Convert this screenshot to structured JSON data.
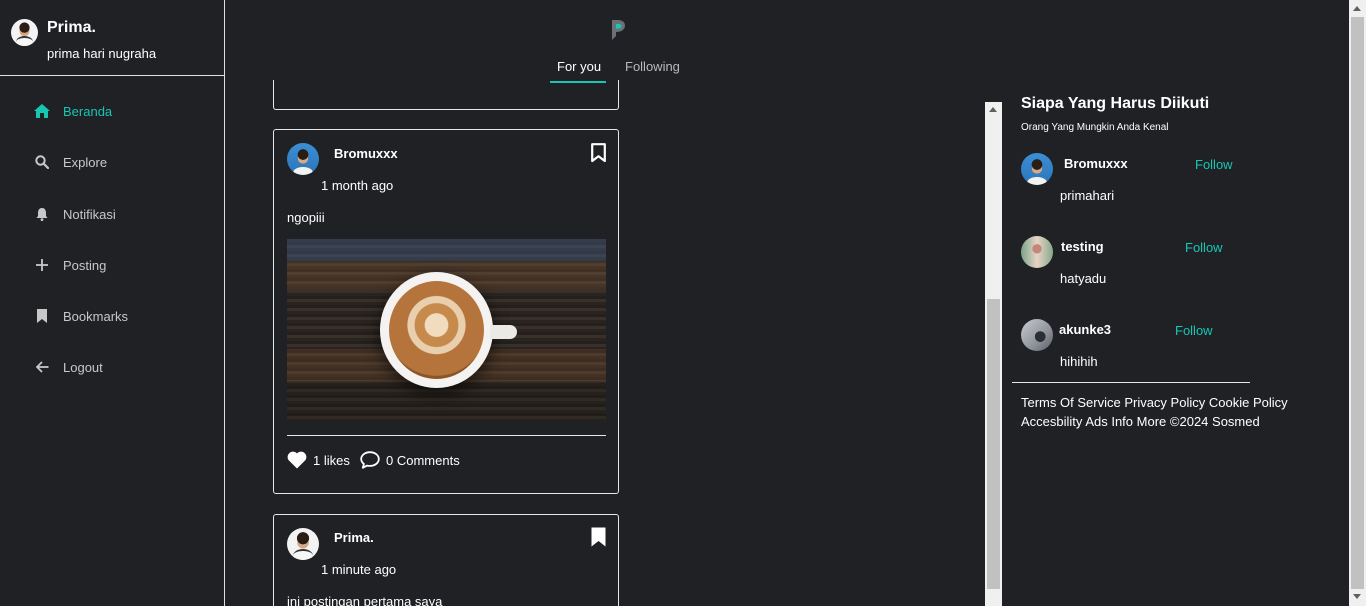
{
  "profile": {
    "name": "Prima.",
    "handle": "prima hari nugraha"
  },
  "nav": [
    {
      "label": "Beranda",
      "icon": "home-icon",
      "active": true
    },
    {
      "label": "Explore",
      "icon": "search-icon"
    },
    {
      "label": "Notifikasi",
      "icon": "bell-icon"
    },
    {
      "label": "Posting",
      "icon": "plus-icon"
    },
    {
      "label": "Bookmarks",
      "icon": "bookmark-icon"
    },
    {
      "label": "Logout",
      "icon": "arrow-left-icon"
    }
  ],
  "tabs": {
    "for_you": "For you",
    "following": "Following"
  },
  "posts": [
    {
      "author": "Bromuxxx",
      "time": "1 month ago",
      "text": "ngopiii",
      "likes": "1 likes",
      "comments": "0 Comments"
    },
    {
      "author": "Prima.",
      "time": "1 minute ago",
      "text": "ini postingan pertama saya"
    }
  ],
  "suggestions": {
    "title": "Siapa Yang Harus Diikuti",
    "subtitle": "Orang Yang Mungkin Anda Kenal",
    "follow_label": "Follow",
    "users": [
      {
        "name": "Bromuxxx",
        "handle": "primahari"
      },
      {
        "name": "testing",
        "handle": "hatyadu"
      },
      {
        "name": "akunke3",
        "handle": "hihihih"
      }
    ]
  },
  "footer": {
    "terms": "Terms Of Service",
    "privacy": "Privacy Policy",
    "cookie": "Cookie Policy",
    "accessibility": "Accesbility",
    "ads": "Ads Info",
    "more": "More",
    "copyright": "©2024 Sosmed"
  },
  "colors": {
    "accent": "#18c6b4",
    "background": "#1f2125",
    "border": "#e6e6e6"
  }
}
